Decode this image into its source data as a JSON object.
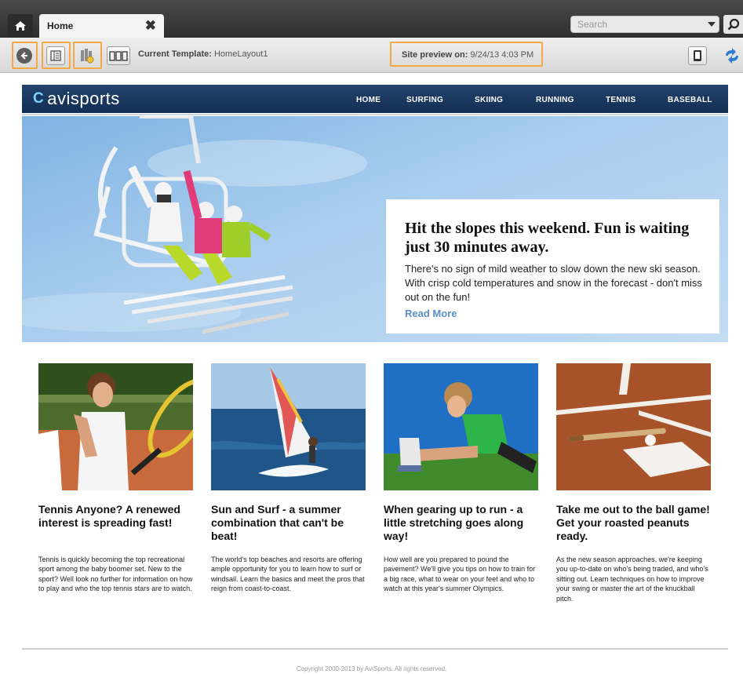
{
  "browser": {
    "tab_label": "Home",
    "tab_close_glyph": "✖",
    "search_placeholder": "Search"
  },
  "toolbar": {
    "current_template_label": "Current Template:",
    "current_template_value": "HomeLayout1",
    "site_preview_label": "Site preview on:",
    "site_preview_value": "9/24/13 4:03 PM"
  },
  "site": {
    "logo_text": "avisports",
    "nav": [
      "HOME",
      "SURFING",
      "SKIING",
      "RUNNING",
      "TENNIS",
      "BASEBALL"
    ],
    "hero": {
      "title": "Hit the slopes this weekend. Fun is waiting just 30 minutes away.",
      "body": "There's no sign of mild weather to slow down the new ski season.  With crisp cold temperatures and snow in the forecast - don't miss out on the fun!",
      "link": "Read More"
    },
    "articles": [
      {
        "title": "Tennis Anyone? A renewed interest is spreading fast!",
        "body": "Tennis is quickly becoming the top recreational sport among the baby boomer set. New to the sport? Well look no further for information on how to play and who the top tennis stars are to watch."
      },
      {
        "title": "Sun and Surf - a summer combination that can't be beat!",
        "body": "The world's top beaches and resorts are offering ample opportunity for you to learn how to surf or windsail.  Learn the basics and meet the pros that reign from coast-to-coast."
      },
      {
        "title": "When gearing up to run - a little stretching goes along way!",
        "body": "How well are you prepared to pound the pavement? We'll give you tips on how to train for a big race, what to wear on your feet and who to watch at this year's summer Olympics."
      },
      {
        "title": "Take me out to the ball game! Get your roasted peanuts ready.",
        "body": "As the new season approaches, we're keeping you up-to-date on who's being traded, and who's sitting out. Learn techniques on how to improve your swing or master the art of the knuckball pitch."
      }
    ],
    "footer": "Copyright 2000-2013 by AviSports. All rights reserved."
  },
  "colors": {
    "header_navy": "#1a3a63",
    "highlight_orange": "#f6a845",
    "link_blue": "#5a8fc7"
  },
  "icons": [
    "home-icon",
    "close-icon",
    "chevron-down-icon",
    "search-icon",
    "back-arrow-icon",
    "layout-icon",
    "edit-slots-icon",
    "devices-icon",
    "mobile-device-icon",
    "sync-icon"
  ]
}
